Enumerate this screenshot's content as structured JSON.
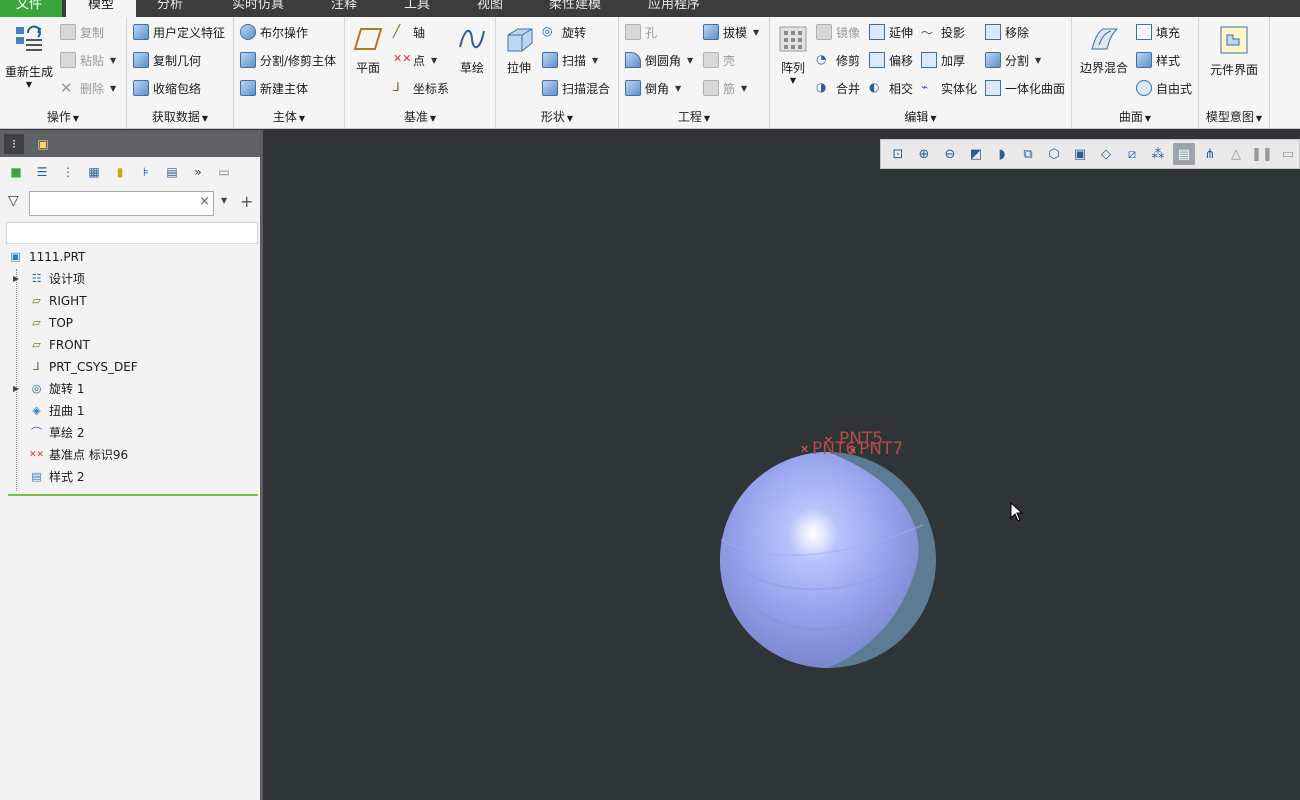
{
  "tabs": [
    "文件",
    "模型",
    "分析",
    "实时仿真",
    "注释",
    "工具",
    "视图",
    "柔性建模",
    "应用程序"
  ],
  "ribbon": {
    "operations": {
      "label": "操作",
      "regen": "重新生成",
      "copy": "复制",
      "paste": "粘贴",
      "delete": "删除"
    },
    "getdata": {
      "label": "获取数据",
      "udf": "用户定义特征",
      "copygeom": "复制几何",
      "shrinkwrap": "收缩包络"
    },
    "body": {
      "label": "主体",
      "boolean": "布尔操作",
      "split": "分割/修剪主体",
      "newbody": "新建主体"
    },
    "datum": {
      "label": "基准",
      "plane": "平面",
      "axis": "轴",
      "point": "点",
      "csys": "坐标系",
      "sketch": "草绘"
    },
    "shapes": {
      "label": "形状",
      "extrude": "拉伸",
      "revolve": "旋转",
      "sweep": "扫描",
      "sweptblend": "扫描混合"
    },
    "engineering": {
      "label": "工程",
      "hole": "孔",
      "round": "倒圆角",
      "chamfer": "倒角",
      "draft": "拔模",
      "shell": "壳",
      "rib": "筋"
    },
    "editing": {
      "label": "编辑",
      "pattern": "阵列",
      "mirror": "镜像",
      "trim": "修剪",
      "merge": "合并",
      "extend": "延伸",
      "offset": "偏移",
      "intersect": "相交",
      "project": "投影",
      "thicken": "加厚",
      "solidify": "实体化",
      "move": "移除",
      "split": "分割",
      "unify": "一体化曲面"
    },
    "surfaces": {
      "label": "曲面",
      "boundary": "边界混合",
      "fill": "填充",
      "style": "样式",
      "freestyle": "自由式"
    },
    "intent": {
      "label": "模型意图",
      "component": "元件界面"
    }
  },
  "search": {
    "value": ""
  },
  "tree": [
    {
      "name": "1111.PRT",
      "icon": "part-icon"
    },
    {
      "name": "设计项",
      "icon": "design-items-icon",
      "expandable": true
    },
    {
      "name": "RIGHT",
      "icon": "datum-plane-icon"
    },
    {
      "name": "TOP",
      "icon": "datum-plane-icon"
    },
    {
      "name": "FRONT",
      "icon": "datum-plane-icon"
    },
    {
      "name": "PRT_CSYS_DEF",
      "icon": "csys-icon"
    },
    {
      "name": "旋转 1",
      "icon": "revolve-icon",
      "expandable": true
    },
    {
      "name": "扭曲 1",
      "icon": "warp-icon"
    },
    {
      "name": "草绘 2",
      "icon": "sketch-icon"
    },
    {
      "name": "基准点 标识96",
      "icon": "datum-point-icon"
    },
    {
      "name": "样式 2",
      "icon": "style-icon"
    }
  ],
  "canvas": {
    "points": [
      "PNT5",
      "PNT6",
      "PNT7"
    ],
    "colors": {
      "background": "#2f3436",
      "sphere": "#97a2ee",
      "sphere_dark": "#5b7c94",
      "point": "#b24a4a"
    }
  }
}
